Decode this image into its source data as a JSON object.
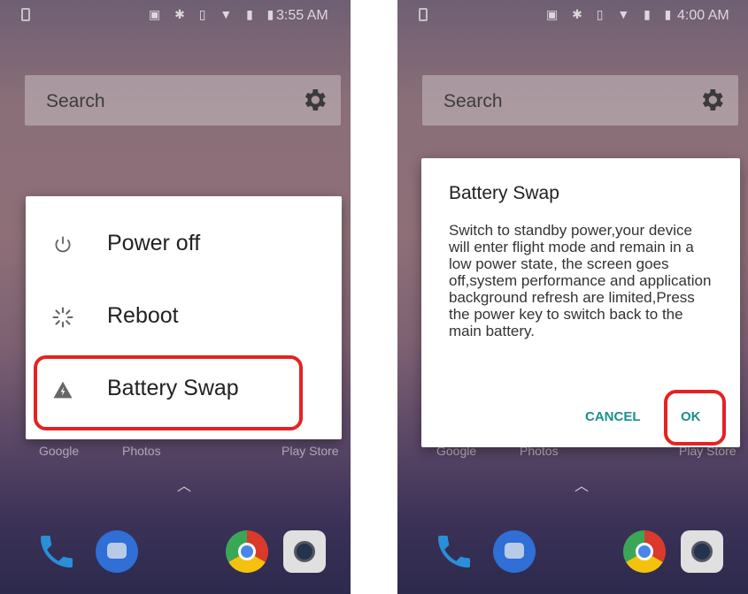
{
  "left_screen": {
    "status": {
      "time": "3:55 AM",
      "icons": [
        "nfc-icon",
        "bluetooth-icon",
        "vibrate-icon",
        "wifi-icon",
        "signal-icon",
        "battery-icon"
      ]
    },
    "search": {
      "label": "Search",
      "icon": "gear-icon"
    },
    "power_menu": {
      "items": [
        {
          "label": "Power off",
          "icon": "power-icon"
        },
        {
          "label": "Reboot",
          "icon": "reboot-icon"
        },
        {
          "label": "Battery Swap",
          "icon": "battery-swap-icon",
          "highlighted": true
        }
      ]
    },
    "dock_labels": [
      "Google",
      "Photos",
      "Play Store"
    ],
    "dock_apps": [
      "phone-app",
      "messages-app",
      "chrome-app",
      "camera-app"
    ]
  },
  "right_screen": {
    "status": {
      "time": "4:00 AM",
      "icons": [
        "nfc-icon",
        "bluetooth-icon",
        "vibrate-icon",
        "wifi-icon",
        "signal-icon",
        "battery-icon"
      ]
    },
    "search": {
      "label": "Search",
      "icon": "gear-icon"
    },
    "dialog": {
      "title": "Battery Swap",
      "body": "Switch to standby power,your device will enter flight mode and remain in a low power state, the screen goes off,system performance and application background refresh are limited,Press the power key to switch back to the main battery.",
      "cancel_label": "CANCEL",
      "ok_label": "OK"
    },
    "dock_labels": [
      "Google",
      "Photos",
      "Play Store"
    ],
    "dock_apps": [
      "phone-app",
      "messages-app",
      "chrome-app",
      "camera-app"
    ]
  },
  "colors": {
    "highlight": "#e52222",
    "accent": "#1a8f8a"
  }
}
